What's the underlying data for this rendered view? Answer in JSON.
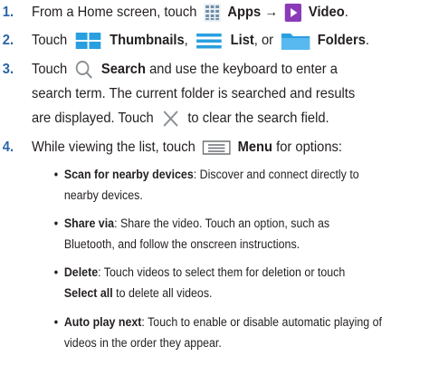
{
  "steps": [
    {
      "num": "1.",
      "pre": "From a Home screen, touch",
      "apps": "Apps",
      "arrow": "→",
      "video": "Video",
      "end": "."
    },
    {
      "num": "2.",
      "pre": "Touch",
      "thumbs": "Thumbnails",
      "sep1": ",",
      "list": "List",
      "sep2": ", or",
      "folders": "Folders",
      "end": "."
    },
    {
      "num": "3.",
      "pre": "Touch",
      "search": "Search",
      "post": "and use the keyboard to enter a",
      "line2": "search term. The current folder is searched and results",
      "line3a": "are displayed. Touch",
      "line3b": "to clear the search field."
    },
    {
      "num": "4.",
      "pre": "While viewing the list, touch",
      "menu": "Menu",
      "post": "for options:"
    }
  ],
  "options": [
    {
      "title": "Scan for nearby devices",
      "desc": ": Discover and connect directly to",
      "desc2": "nearby devices."
    },
    {
      "title": "Share via",
      "desc": ": Share the video. Touch an option, such as",
      "desc2": "Bluetooth, and follow the onscreen instructions."
    },
    {
      "title": "Delete",
      "desc": ": Touch videos to select them for deletion or touch",
      "desc2b": "Select all",
      "desc2": " to delete all videos."
    },
    {
      "title": "Auto play next",
      "desc": ": Touch to enable or disable automatic playing of",
      "desc2": "videos in the order they appear."
    }
  ],
  "colors": {
    "step_number": "#2b64a8",
    "icon_blue": "#2a9fe0",
    "video_purple": "#8b3bb8"
  }
}
